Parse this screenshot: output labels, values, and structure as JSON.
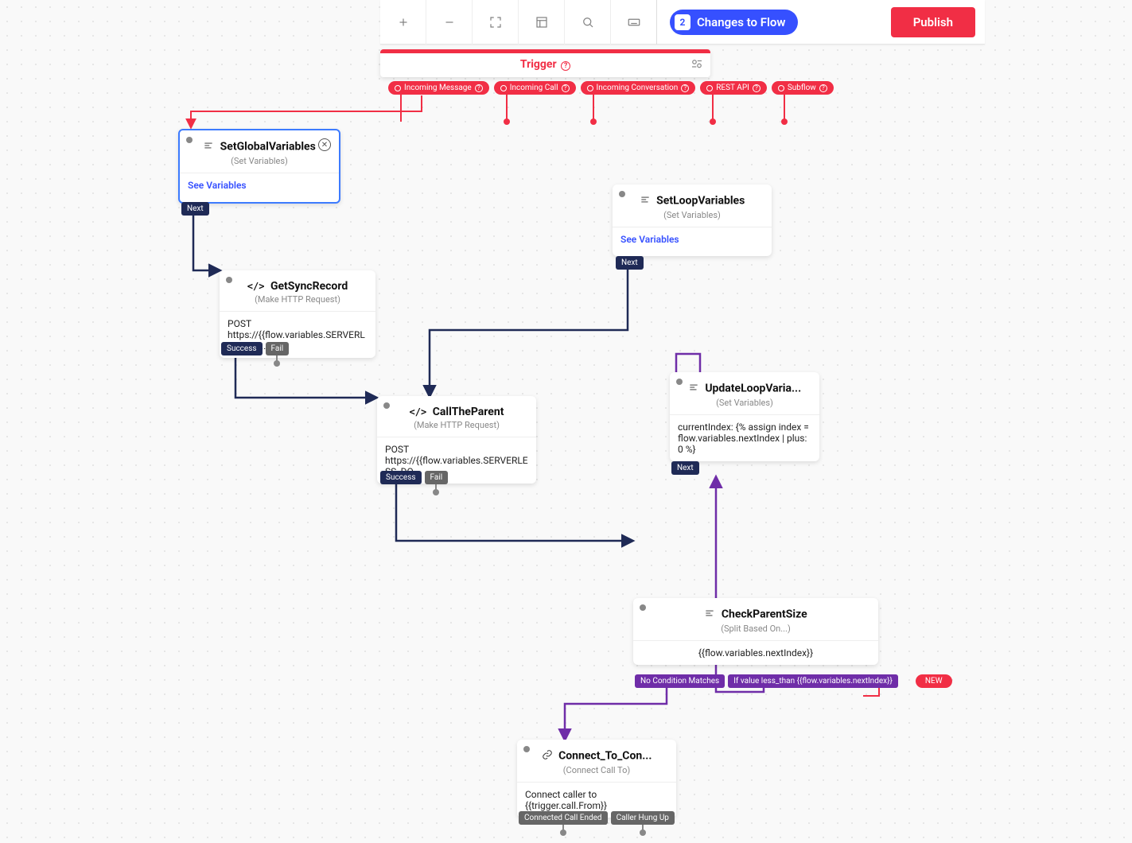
{
  "toolbar": {
    "changes_count": "2",
    "changes_label": "Changes to Flow",
    "publish_label": "Publish"
  },
  "trigger": {
    "title": "Trigger",
    "pills": [
      "Incoming Message",
      "Incoming Call",
      "Incoming Conversation",
      "REST API",
      "Subflow"
    ]
  },
  "widgets": {
    "setGlobal": {
      "title": "SetGlobalVariables",
      "sub": "(Set Variables)",
      "see": "See Variables",
      "next": "Next"
    },
    "getSync": {
      "title": "GetSyncRecord",
      "sub": "(Make HTTP Request)",
      "body": "POST\nhttps://{{flow.variables.SERVERLESS_DO...",
      "success": "Success",
      "fail": "Fail"
    },
    "callParent": {
      "title": "CallTheParent",
      "sub": "(Make HTTP Request)",
      "body": "POST\nhttps://{{flow.variables.SERVERLESS_DO...",
      "success": "Success",
      "fail": "Fail"
    },
    "setLoop": {
      "title": "SetLoopVariables",
      "sub": "(Set Variables)",
      "see": "See Variables",
      "next": "Next"
    },
    "updateLoop": {
      "title": "UpdateLoopVaria...",
      "sub": "(Set Variables)",
      "body": "currentIndex: {% assign index = flow.variables.nextIndex | plus: 0 %}",
      "next": "Next"
    },
    "checkParent": {
      "title": "CheckParentSize",
      "sub": "(Split Based On...)",
      "body": "{{flow.variables.nextIndex}}",
      "no_match": "No Condition Matches",
      "cond": "If value less_than {{flow.variables.nextIndex}}",
      "new": "NEW"
    },
    "connect": {
      "title": "Connect_To_Con...",
      "sub": "(Connect Call To)",
      "body": "Connect caller to {{trigger.call.From}}",
      "ended": "Connected Call Ended",
      "hangup": "Caller Hung Up"
    }
  }
}
